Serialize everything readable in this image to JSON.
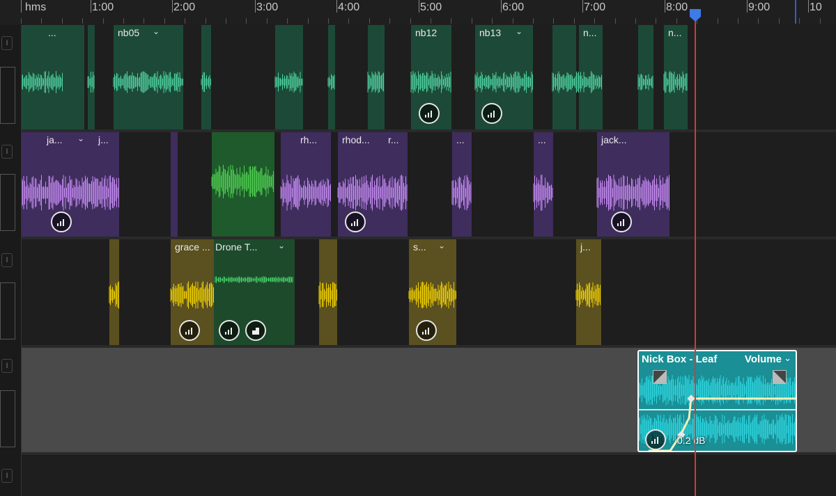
{
  "ruler": {
    "format_label": "hms",
    "ticks": [
      "1:00",
      "2:00",
      "3:00",
      "4:00",
      "5:00",
      "6:00",
      "7:00",
      "8:00",
      "9:00",
      "10"
    ]
  },
  "track_header": {
    "i_label": "I"
  },
  "tracks": [
    {
      "clips": [
        {
          "title": "...",
          "kind": "green"
        },
        {
          "title": "nb05",
          "kind": "green",
          "has_menu": true
        },
        {
          "title": "nb12",
          "kind": "green"
        },
        {
          "title": "nb13",
          "kind": "green",
          "has_menu": true
        },
        {
          "title": "n...",
          "kind": "green"
        },
        {
          "title": "n...",
          "kind": "green"
        }
      ]
    },
    {
      "clips": [
        {
          "title": "ja...",
          "kind": "purple",
          "has_menu": true
        },
        {
          "title": "j...",
          "kind": "purple"
        },
        {
          "title": "rh...",
          "kind": "purple"
        },
        {
          "title": "rhod...",
          "kind": "purple"
        },
        {
          "title": "r...",
          "kind": "purple"
        },
        {
          "title": "...",
          "kind": "purple"
        },
        {
          "title": "...",
          "kind": "purple"
        },
        {
          "title": "jack...",
          "kind": "purple"
        }
      ]
    },
    {
      "clips": [
        {
          "title": "grace ...",
          "kind": "yellow"
        },
        {
          "title": "Drone T...",
          "kind": "green",
          "has_menu": true
        },
        {
          "title": "s...",
          "kind": "yellow",
          "has_menu": true
        },
        {
          "title": "j...",
          "kind": "yellow"
        }
      ]
    }
  ],
  "selected_clip": {
    "title": "Nick Box - Leaf",
    "param": "Volume",
    "db_readout": "0.2 dB"
  },
  "colors": {
    "green": "#1d4a38",
    "green_wave": "#4fd1a0",
    "purple": "#3f2d5e",
    "purple_wave": "#c68cf3",
    "yellow": "#5a5020",
    "yellow_wave": "#f3d200",
    "teal": "#1a8f95",
    "teal_wave": "#2ed6e0",
    "playhead": "#d43a3a"
  },
  "icons": {
    "badge": "clip-radio-badge-icon",
    "fx": "clip-fx-badge-icon",
    "playhead_marker": "playhead-marker-icon",
    "fade": "fade-handle-icon",
    "chevron": "chevron-down-icon"
  }
}
